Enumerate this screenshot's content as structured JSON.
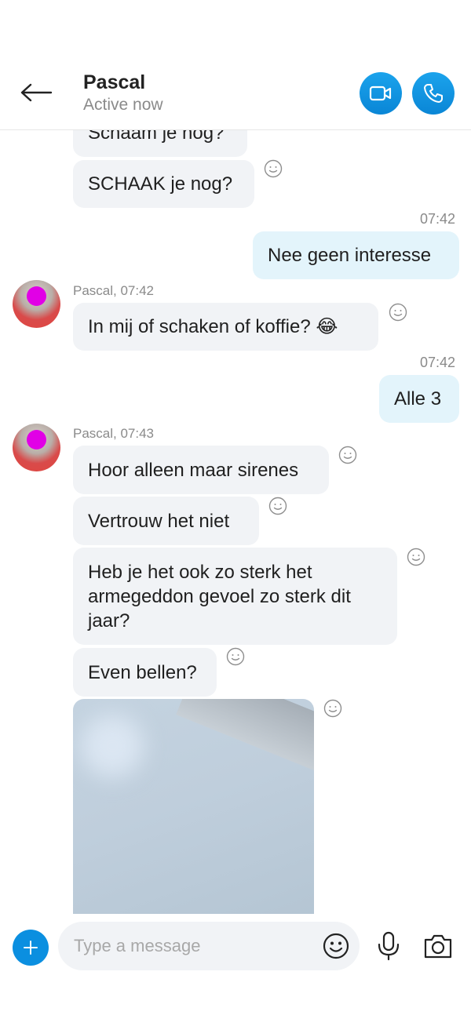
{
  "header": {
    "contact_name": "Pascal",
    "status": "Active now",
    "accent_color": "#0b8fe0"
  },
  "messages": [
    {
      "id": "m1",
      "direction": "incoming",
      "text": "Schaam je nog?",
      "partially_visible": true
    },
    {
      "id": "m2",
      "direction": "incoming",
      "text": "SCHAAK je nog?"
    },
    {
      "id": "m3",
      "direction": "outgoing",
      "time": "07:42",
      "text": "Nee geen interesse"
    },
    {
      "id": "m4",
      "direction": "incoming",
      "sender_line": "Pascal, 07:42",
      "text": "In mij of schaken of koffie? 😂"
    },
    {
      "id": "m5",
      "direction": "outgoing",
      "time": "07:42",
      "text": "Alle 3"
    },
    {
      "id": "m6",
      "direction": "incoming",
      "sender_line": "Pascal, 07:43",
      "text": "Hoor alleen maar sirenes"
    },
    {
      "id": "m7",
      "direction": "incoming",
      "text": "Vertrouw het niet"
    },
    {
      "id": "m8",
      "direction": "incoming",
      "text": "Heb je het ook zo sterk het armegeddon gevoel zo sterk dit jaar?"
    },
    {
      "id": "m9",
      "direction": "incoming",
      "text": "Even bellen?"
    },
    {
      "id": "m10",
      "direction": "incoming",
      "type": "image"
    }
  ],
  "composer": {
    "placeholder": "Type a message"
  },
  "icons": {
    "back": "arrow-left-icon",
    "video": "video-camera-icon",
    "phone": "phone-icon",
    "add": "plus-icon",
    "emoji": "smiley-icon",
    "mic": "microphone-icon",
    "camera": "camera-icon",
    "reaction": "smiley-outline-icon"
  }
}
